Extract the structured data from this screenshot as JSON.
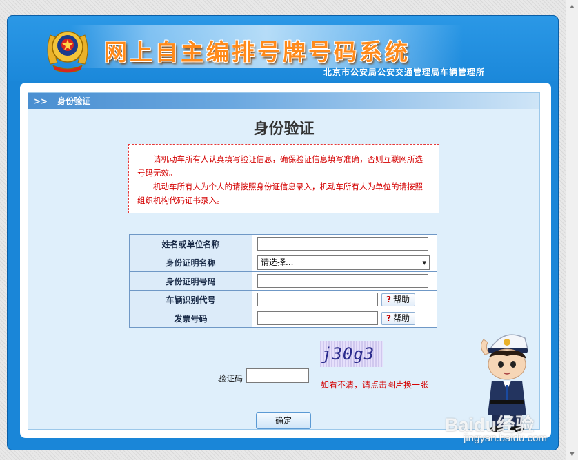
{
  "header": {
    "title": "网上自主编排号牌号码系统",
    "subtitle": "北京市公安局公安交通管理局车辆管理所"
  },
  "section": {
    "arrows": ">>",
    "label": "身份验证"
  },
  "page_title": "身份验证",
  "notice": {
    "line1": "请机动车所有人认真填写验证信息，确保验证信息填写准确，否则互联网所选号码无效。",
    "line2": "机动车所有人为个人的请按照身份证信息录入，机动车所有人为单位的请按照组织机构代码证书录入。"
  },
  "form": {
    "name_label": "姓名或单位名称",
    "name_value": "",
    "id_type_label": "身份证明名称",
    "id_type_selected": "请选择...",
    "id_number_label": "身份证明号码",
    "id_number_value": "",
    "vin_label": "车辆识别代号",
    "vin_value": "",
    "invoice_label": "发票号码",
    "invoice_value": "",
    "help_label": "帮助",
    "help_icon": "?"
  },
  "captcha": {
    "label": "验证码",
    "value": "",
    "image_text": "j30g3",
    "hint": "如看不清，请点击图片换一张"
  },
  "submit_label": "确定",
  "watermark": {
    "brand": "Baidu经验",
    "url": "jingyan.baidu.com"
  },
  "colors": {
    "frame_blue": "#1a86d8",
    "title_orange": "#ff8a1a",
    "notice_red": "#d40000",
    "label_bg": "#dcebf9"
  }
}
